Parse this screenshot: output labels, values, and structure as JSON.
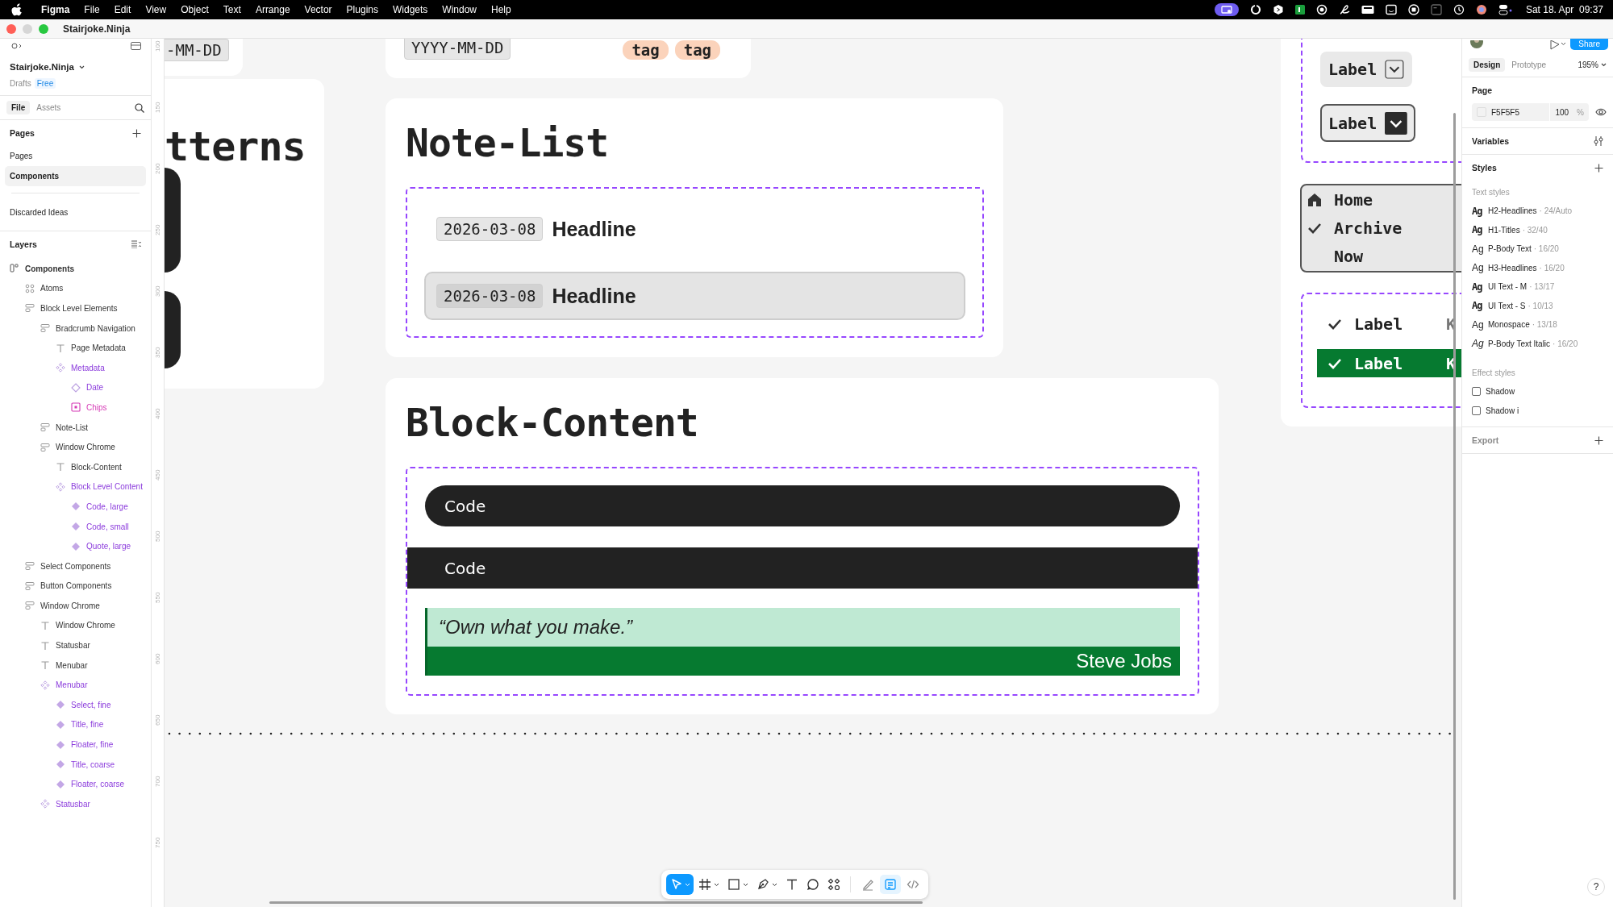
{
  "menubar": {
    "app": "Figma",
    "menus": [
      "File",
      "Edit",
      "View",
      "Object",
      "Text",
      "Arrange",
      "Vector",
      "Plugins",
      "Widgets",
      "Window",
      "Help"
    ],
    "clock": "Sat 18. Apr  09:37"
  },
  "window": {
    "title": "Stairjoke.Ninja"
  },
  "left_panel": {
    "file_name": "Stairjoke.Ninja",
    "plan": "Drafts",
    "badge": "Free",
    "tabs": [
      {
        "label": "File",
        "selected": true
      },
      {
        "label": "Assets",
        "selected": false
      }
    ],
    "pages_heading": "Pages",
    "pages": [
      {
        "kind": "page",
        "label": "Pages",
        "selected": false
      },
      {
        "kind": "page",
        "label": "Components",
        "selected": true
      },
      {
        "kind": "divider"
      },
      {
        "kind": "page",
        "label": "Discarded Ideas",
        "selected": false
      }
    ],
    "layers_heading": "Layers",
    "layers": [
      {
        "label": "Components",
        "kind": "frame",
        "children": [
          {
            "label": "Atoms",
            "kind": "grid"
          },
          {
            "label": "Block Level Elements",
            "kind": "stack",
            "children": [
              {
                "label": "Bradcrumb Navigation",
                "kind": "stack",
                "children": [
                  {
                    "label": "Page Metadata",
                    "kind": "text"
                  },
                  {
                    "label": "Metadata",
                    "kind": "component-set",
                    "children": [
                      {
                        "label": "Date",
                        "kind": "component"
                      },
                      {
                        "label": "Chips",
                        "kind": "instance"
                      }
                    ]
                  }
                ]
              },
              {
                "label": "Note-List",
                "kind": "stack"
              },
              {
                "label": "Window Chrome",
                "kind": "stack",
                "children": [
                  {
                    "label": "Block-Content",
                    "kind": "text"
                  },
                  {
                    "label": "Block Level Content",
                    "kind": "component-set",
                    "children": [
                      {
                        "label": "Code, large",
                        "kind": "variant"
                      },
                      {
                        "label": "Code, small",
                        "kind": "variant"
                      },
                      {
                        "label": "Quote, large",
                        "kind": "variant"
                      }
                    ]
                  }
                ]
              }
            ]
          },
          {
            "label": "Select Components",
            "kind": "stack"
          },
          {
            "label": "Button Components",
            "kind": "stack"
          },
          {
            "label": "Window Chrome",
            "kind": "stack",
            "children": [
              {
                "label": "Window Chrome",
                "kind": "text"
              },
              {
                "label": "Statusbar",
                "kind": "text"
              },
              {
                "label": "Menubar",
                "kind": "text"
              },
              {
                "label": "Menubar",
                "kind": "component-set",
                "children": [
                  {
                    "label": "Select, fine",
                    "kind": "variant"
                  },
                  {
                    "label": "Title, fine",
                    "kind": "variant"
                  },
                  {
                    "label": "Floater, fine",
                    "kind": "variant"
                  },
                  {
                    "label": "Title, coarse",
                    "kind": "variant"
                  },
                  {
                    "label": "Floater, coarse",
                    "kind": "variant"
                  }
                ]
              },
              {
                "label": "Statusbar",
                "kind": "component-set"
              }
            ]
          }
        ]
      }
    ]
  },
  "canvas": {
    "ruler_marks": [
      "100",
      "150",
      "200",
      "250",
      "300",
      "350",
      "400",
      "450",
      "500",
      "550",
      "600",
      "650",
      "700",
      "750"
    ],
    "patterns_frame": {
      "heading": "tterns"
    },
    "metadata_strip": {
      "date_chip": "-MM-DD"
    },
    "metadata_card": {
      "date_chip": "YYYY-MM-DD",
      "tags": [
        "tag",
        "tag"
      ]
    },
    "note_list": {
      "title": "Note-List",
      "notes": [
        {
          "date": "2026-03-08",
          "headline": "Headline",
          "selected": false
        },
        {
          "date": "2026-03-08",
          "headline": "Headline",
          "selected": true
        }
      ]
    },
    "block_content": {
      "title": "Block-Content",
      "blocks": [
        {
          "kind": "code-large",
          "text": "Code"
        },
        {
          "kind": "code-small",
          "text": "Code"
        },
        {
          "kind": "quote",
          "text": "“Own what you make.”",
          "author": "Steve Jobs"
        }
      ]
    },
    "selects": [
      {
        "kind": "fine",
        "label": "Label"
      },
      {
        "kind": "coarse",
        "label": "Label"
      }
    ],
    "menu": [
      {
        "kind": "home",
        "label": "Home",
        "checked": false
      },
      {
        "kind": "item",
        "label": "Archive",
        "checked": true
      },
      {
        "kind": "item",
        "label": "Now",
        "checked": false
      }
    ],
    "options": [
      {
        "label": "Label",
        "shortcut": "K",
        "checked": true,
        "selected": false
      },
      {
        "label": "Label",
        "shortcut": "K",
        "checked": true,
        "selected": true
      }
    ]
  },
  "toolbar": {
    "tools": [
      {
        "kind": "move",
        "selected": true
      },
      {
        "kind": "frame",
        "selected": false
      },
      {
        "kind": "shape",
        "selected": false
      },
      {
        "kind": "pen",
        "selected": false
      },
      {
        "kind": "text",
        "selected": false
      },
      {
        "kind": "comment",
        "selected": false
      },
      {
        "kind": "actions",
        "selected": false
      }
    ],
    "modes": [
      {
        "kind": "draw",
        "selected": false
      },
      {
        "kind": "design",
        "selected": true
      },
      {
        "kind": "dev",
        "selected": false
      }
    ]
  },
  "help_button": "?",
  "right_panel": {
    "share": "Share",
    "tabs": [
      {
        "label": "Design",
        "selected": true
      },
      {
        "label": "Prototype",
        "selected": false
      }
    ],
    "zoom": "195%",
    "page_heading": "Page",
    "page_color": "F5F5F5",
    "page_opacity": "100",
    "opacity_unit": "%",
    "variables_heading": "Variables",
    "styles_heading": "Styles",
    "text_styles_heading": "Text styles",
    "text_styles": [
      {
        "sample": "Ag",
        "kind": "display",
        "name": "H2-Headlines",
        "spec": "· 24/Auto"
      },
      {
        "sample": "Ag",
        "kind": "display",
        "name": "H1-Titles",
        "spec": "· 32/40"
      },
      {
        "sample": "Ag",
        "kind": "regular",
        "name": "P-Body Text",
        "spec": "· 16/20"
      },
      {
        "sample": "Ag",
        "kind": "regular",
        "name": "H3-Headlines",
        "spec": "· 16/20"
      },
      {
        "sample": "Ag",
        "kind": "display",
        "name": "UI Text - M",
        "spec": "· 13/17"
      },
      {
        "sample": "Ag",
        "kind": "display",
        "name": "UI Text - S",
        "spec": "· 10/13"
      },
      {
        "sample": "Ag",
        "kind": "regular",
        "name": "Monospace",
        "spec": "· 13/18"
      },
      {
        "sample": "Ag",
        "kind": "italic",
        "name": "P-Body Text Italic",
        "spec": "· 16/20"
      }
    ],
    "effect_styles_heading": "Effect styles",
    "effect_styles": [
      "Shadow",
      "Shadow i"
    ],
    "export_heading": "Export"
  }
}
